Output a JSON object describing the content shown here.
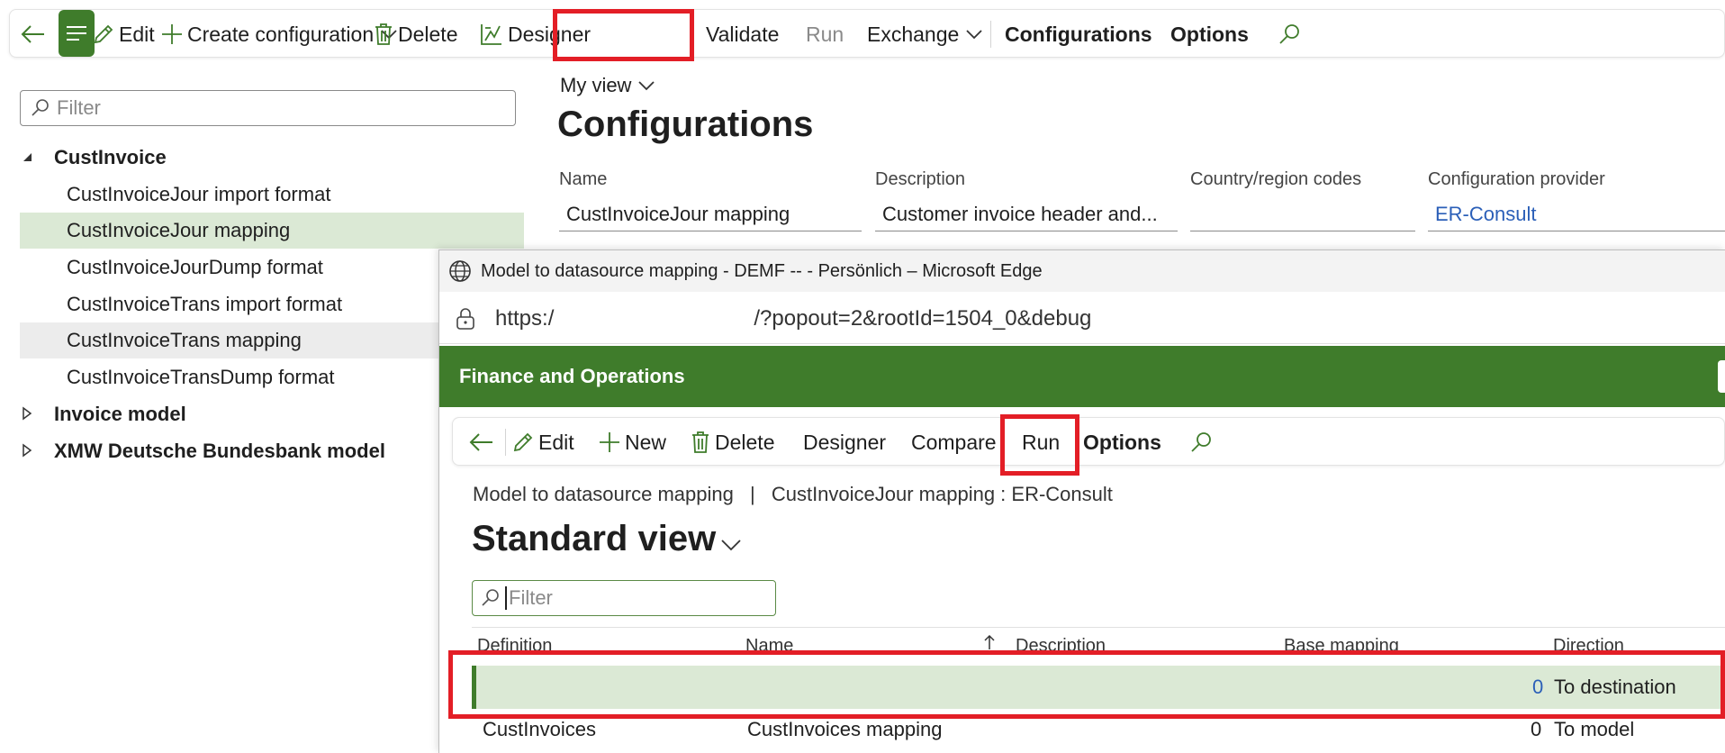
{
  "toolbar": {
    "edit": "Edit",
    "create_configuration": "Create configuration",
    "delete": "Delete",
    "designer": "Designer",
    "validate": "Validate",
    "run": "Run",
    "exchange": "Exchange",
    "configurations": "Configurations",
    "options": "Options"
  },
  "left_pane": {
    "filter_placeholder": "Filter",
    "tree": [
      {
        "label": "CustInvoice",
        "level": 0,
        "expanded": true
      },
      {
        "label": "CustInvoiceJour import format",
        "level": 1
      },
      {
        "label": "CustInvoiceJour mapping",
        "level": 1,
        "selected": true
      },
      {
        "label": "CustInvoiceJourDump format",
        "level": 1
      },
      {
        "label": "CustInvoiceTrans import format",
        "level": 1
      },
      {
        "label": "CustInvoiceTrans mapping",
        "level": 1,
        "hovered": true
      },
      {
        "label": "CustInvoiceTransDump format",
        "level": 1
      },
      {
        "label": "Invoice model",
        "level": 0,
        "expanded": false
      },
      {
        "label": "XMW Deutsche Bundesbank model",
        "level": 0,
        "expanded": false
      }
    ]
  },
  "details": {
    "view_selector": "My view",
    "title": "Configurations",
    "fields": {
      "name_label": "Name",
      "name_value": "CustInvoiceJour mapping",
      "description_label": "Description",
      "description_value": "Customer invoice header and...",
      "country_label": "Country/region codes",
      "country_value": "",
      "provider_label": "Configuration provider",
      "provider_value": "ER-Consult"
    }
  },
  "popup": {
    "window_title": "Model to datasource mapping - DEMF -- - Persönlich – Microsoft Edge",
    "url_left": "https:/",
    "url_right": "/?popout=2&rootId=1504_0&debug",
    "app_title": "Finance and Operations",
    "toolbar": {
      "edit": "Edit",
      "new": "New",
      "delete": "Delete",
      "designer": "Designer",
      "compare": "Compare",
      "run": "Run",
      "options": "Options"
    },
    "breadcrumb": {
      "left": "Model to datasource mapping",
      "separator": "|",
      "right": "CustInvoiceJour mapping : ER-Consult"
    },
    "view_title": "Standard view",
    "filter_placeholder": "Filter",
    "grid": {
      "columns": [
        "Definition",
        "Name",
        "Description",
        "Base mapping",
        "Direction"
      ],
      "rows": [
        {
          "definition": "",
          "name": "",
          "description": "",
          "base_mapping": "0",
          "direction": "To destination",
          "selected": true
        },
        {
          "definition": "CustInvoices",
          "name": "CustInvoices mapping",
          "description": "",
          "base_mapping": "0",
          "direction": "To model"
        }
      ]
    }
  },
  "colors": {
    "accent_green": "#3f7c2b",
    "selected_row": "#dbe9d5",
    "highlight_red": "#e31e26",
    "link_blue": "#2b5fb8"
  }
}
